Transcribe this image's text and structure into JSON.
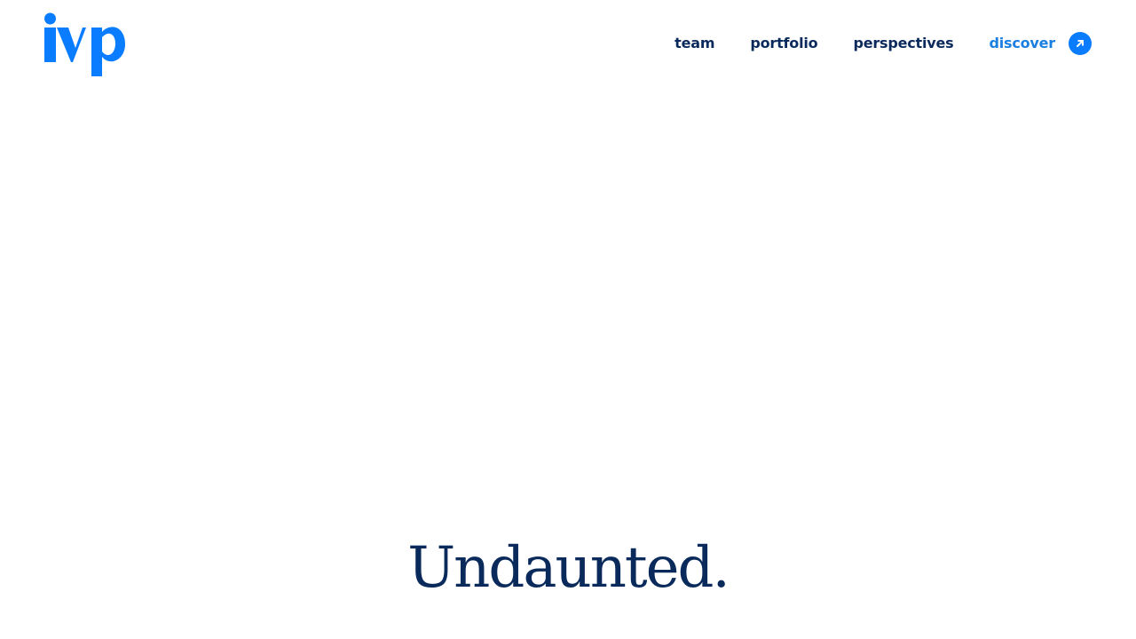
{
  "brand": {
    "logo_text": "ivp",
    "accent_color": "#0a7cff",
    "navy_color": "#0b2a5c"
  },
  "nav": {
    "items": [
      {
        "label": "team"
      },
      {
        "label": "portfolio"
      },
      {
        "label": "perspectives"
      }
    ],
    "discover": {
      "label": "discover",
      "icon": "arrow-up-right-icon",
      "color": "#1a7fe0"
    }
  },
  "hero": {
    "headline": "Undaunted."
  }
}
